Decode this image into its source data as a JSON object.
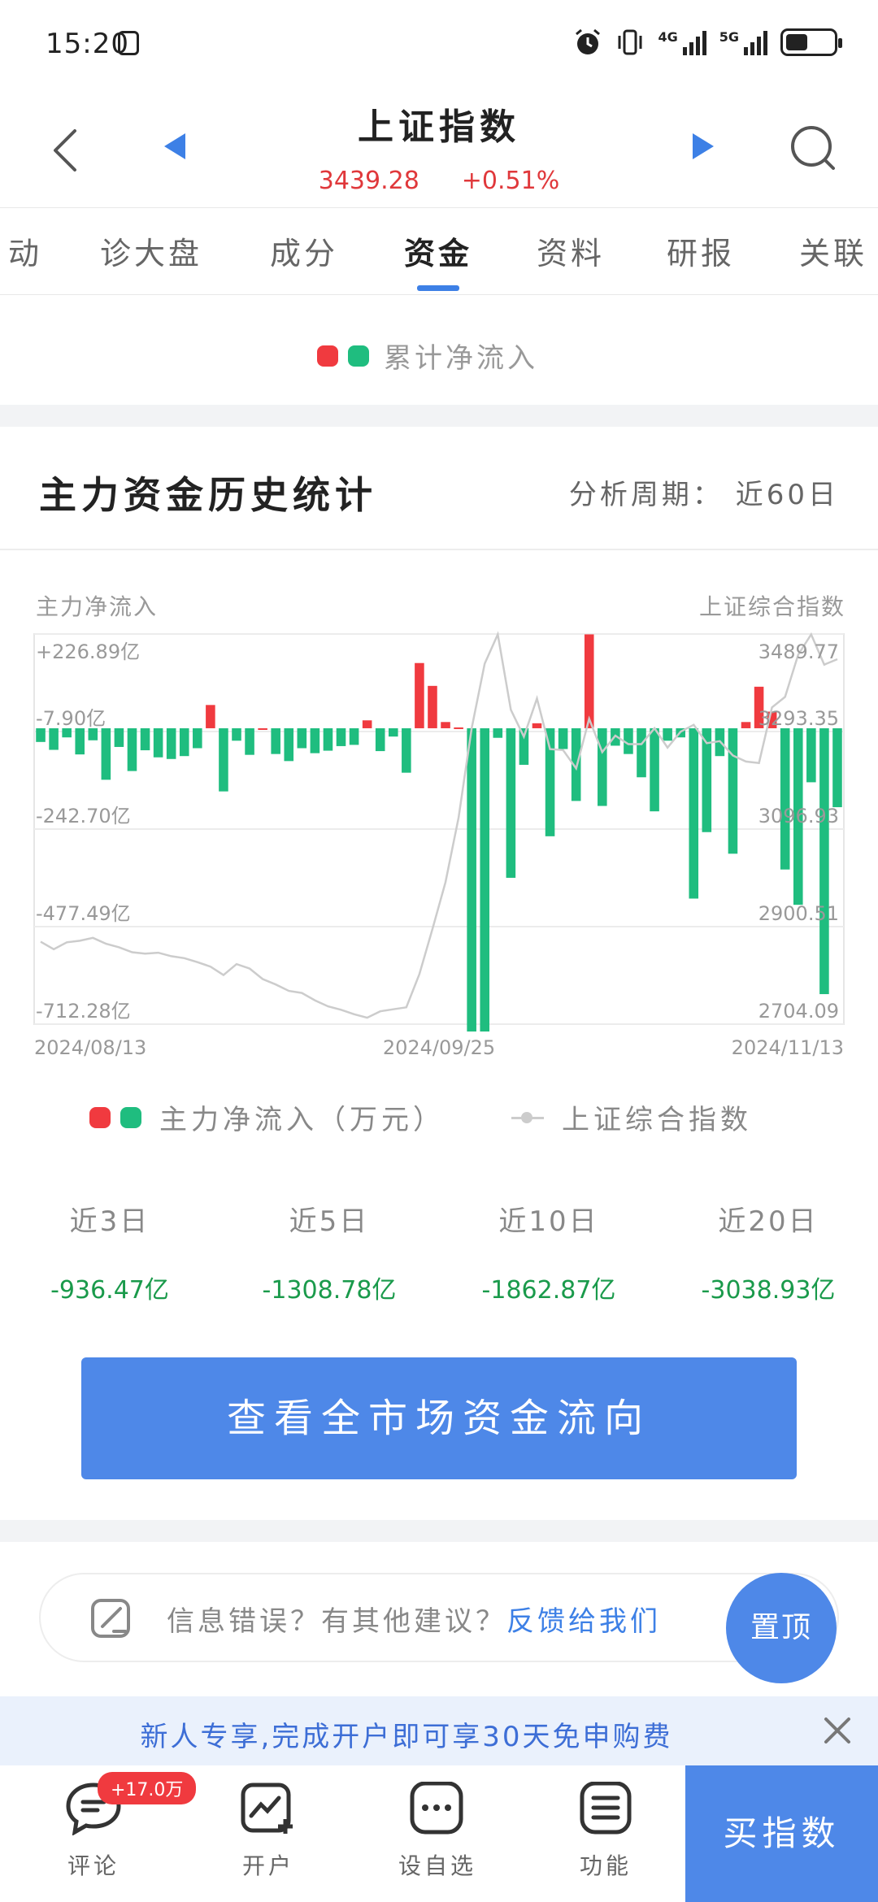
{
  "status_bar": {
    "time": "15:20",
    "net_4g": "4G",
    "net_5g": "5G"
  },
  "header": {
    "title": "上证指数",
    "price": "3439.28",
    "change": "+0.51%"
  },
  "tabs": [
    "动",
    "诊大盘",
    "成分",
    "资金",
    "资料",
    "研报",
    "关联"
  ],
  "active_tab": "资金",
  "top_legend": {
    "label": "累计净流入"
  },
  "section": {
    "title": "主力资金历史统计",
    "period_label": "分析周期：",
    "period_value": "近60日",
    "left_axis_title": "主力净流入",
    "right_axis_title": "上证综合指数"
  },
  "legend": {
    "flow": "主力净流入（万元）",
    "index": "上证综合指数"
  },
  "stats": [
    {
      "label": "近3日",
      "value": "-936.47亿"
    },
    {
      "label": "近5日",
      "value": "-1308.78亿"
    },
    {
      "label": "近10日",
      "value": "-1862.87亿"
    },
    {
      "label": "近20日",
      "value": "-3038.93亿"
    }
  ],
  "main_button": "查看全市场资金流向",
  "feedback": {
    "text": "信息错误？有其他建议？",
    "link": "反馈给我们"
  },
  "top_button": "置顶",
  "promo": "新人专享,完成开户即可享30天免申购费",
  "bottom_nav": {
    "comment": "评论",
    "comment_badge": "+17.0万",
    "open": "开户",
    "watch": "设自选",
    "func": "功能",
    "buy": "买指数"
  },
  "chart_data": {
    "type": "bar",
    "title": "",
    "x_start": "2024/08/13",
    "x_mid": "2024/09/25",
    "x_end": "2024/11/13",
    "left_ticks": [
      "+226.89亿",
      "-7.90亿",
      "-242.70亿",
      "-477.49亿",
      "-712.28亿"
    ],
    "right_ticks": [
      "3489.77",
      "3293.35",
      "3096.93",
      "2900.51",
      "2704.09"
    ],
    "ylim_left": [
      -712.28,
      226.89
    ],
    "ylim_right": [
      2704.09,
      3489.77
    ],
    "colors": {
      "inflow": "#f03a3f",
      "outflow": "#1fbd7f",
      "index": "#cccccc"
    },
    "series": [
      {
        "name": "主力净流入（万元）",
        "values": [
          -33,
          -52,
          -22,
          -63,
          -29,
          -124,
          -45,
          -103,
          -53,
          -70,
          -74,
          -67,
          -48,
          56,
          -152,
          -30,
          -64,
          0,
          -62,
          -79,
          -48,
          -60,
          -54,
          -43,
          -40,
          19,
          -55,
          -20,
          -107,
          157,
          102,
          15,
          2,
          -730,
          -730,
          -23,
          -360,
          -88,
          12,
          -260,
          -50,
          -175,
          226,
          -187,
          -42,
          -62,
          -118,
          -200,
          -30,
          -22,
          -410,
          -250,
          -67,
          -302,
          15,
          100,
          40,
          -340,
          -425,
          -130,
          -640,
          -190
        ]
      },
      {
        "name": "上证综合指数",
        "values": [
          2870,
          2855,
          2869,
          2872,
          2878,
          2866,
          2859,
          2849,
          2846,
          2848,
          2841,
          2837,
          2829,
          2820,
          2803,
          2825,
          2816,
          2795,
          2784,
          2771,
          2767,
          2752,
          2740,
          2733,
          2724,
          2717,
          2730,
          2734,
          2738,
          2805,
          2896,
          2990,
          3120,
          3300,
          3430,
          3489,
          3337,
          3283,
          3360,
          3258,
          3256,
          3219,
          3319,
          3252,
          3285,
          3268,
          3268,
          3300,
          3261,
          3293,
          3307,
          3270,
          3274,
          3245,
          3233,
          3230,
          3342,
          3363,
          3448,
          3489,
          3428,
          3439
        ]
      }
    ]
  }
}
